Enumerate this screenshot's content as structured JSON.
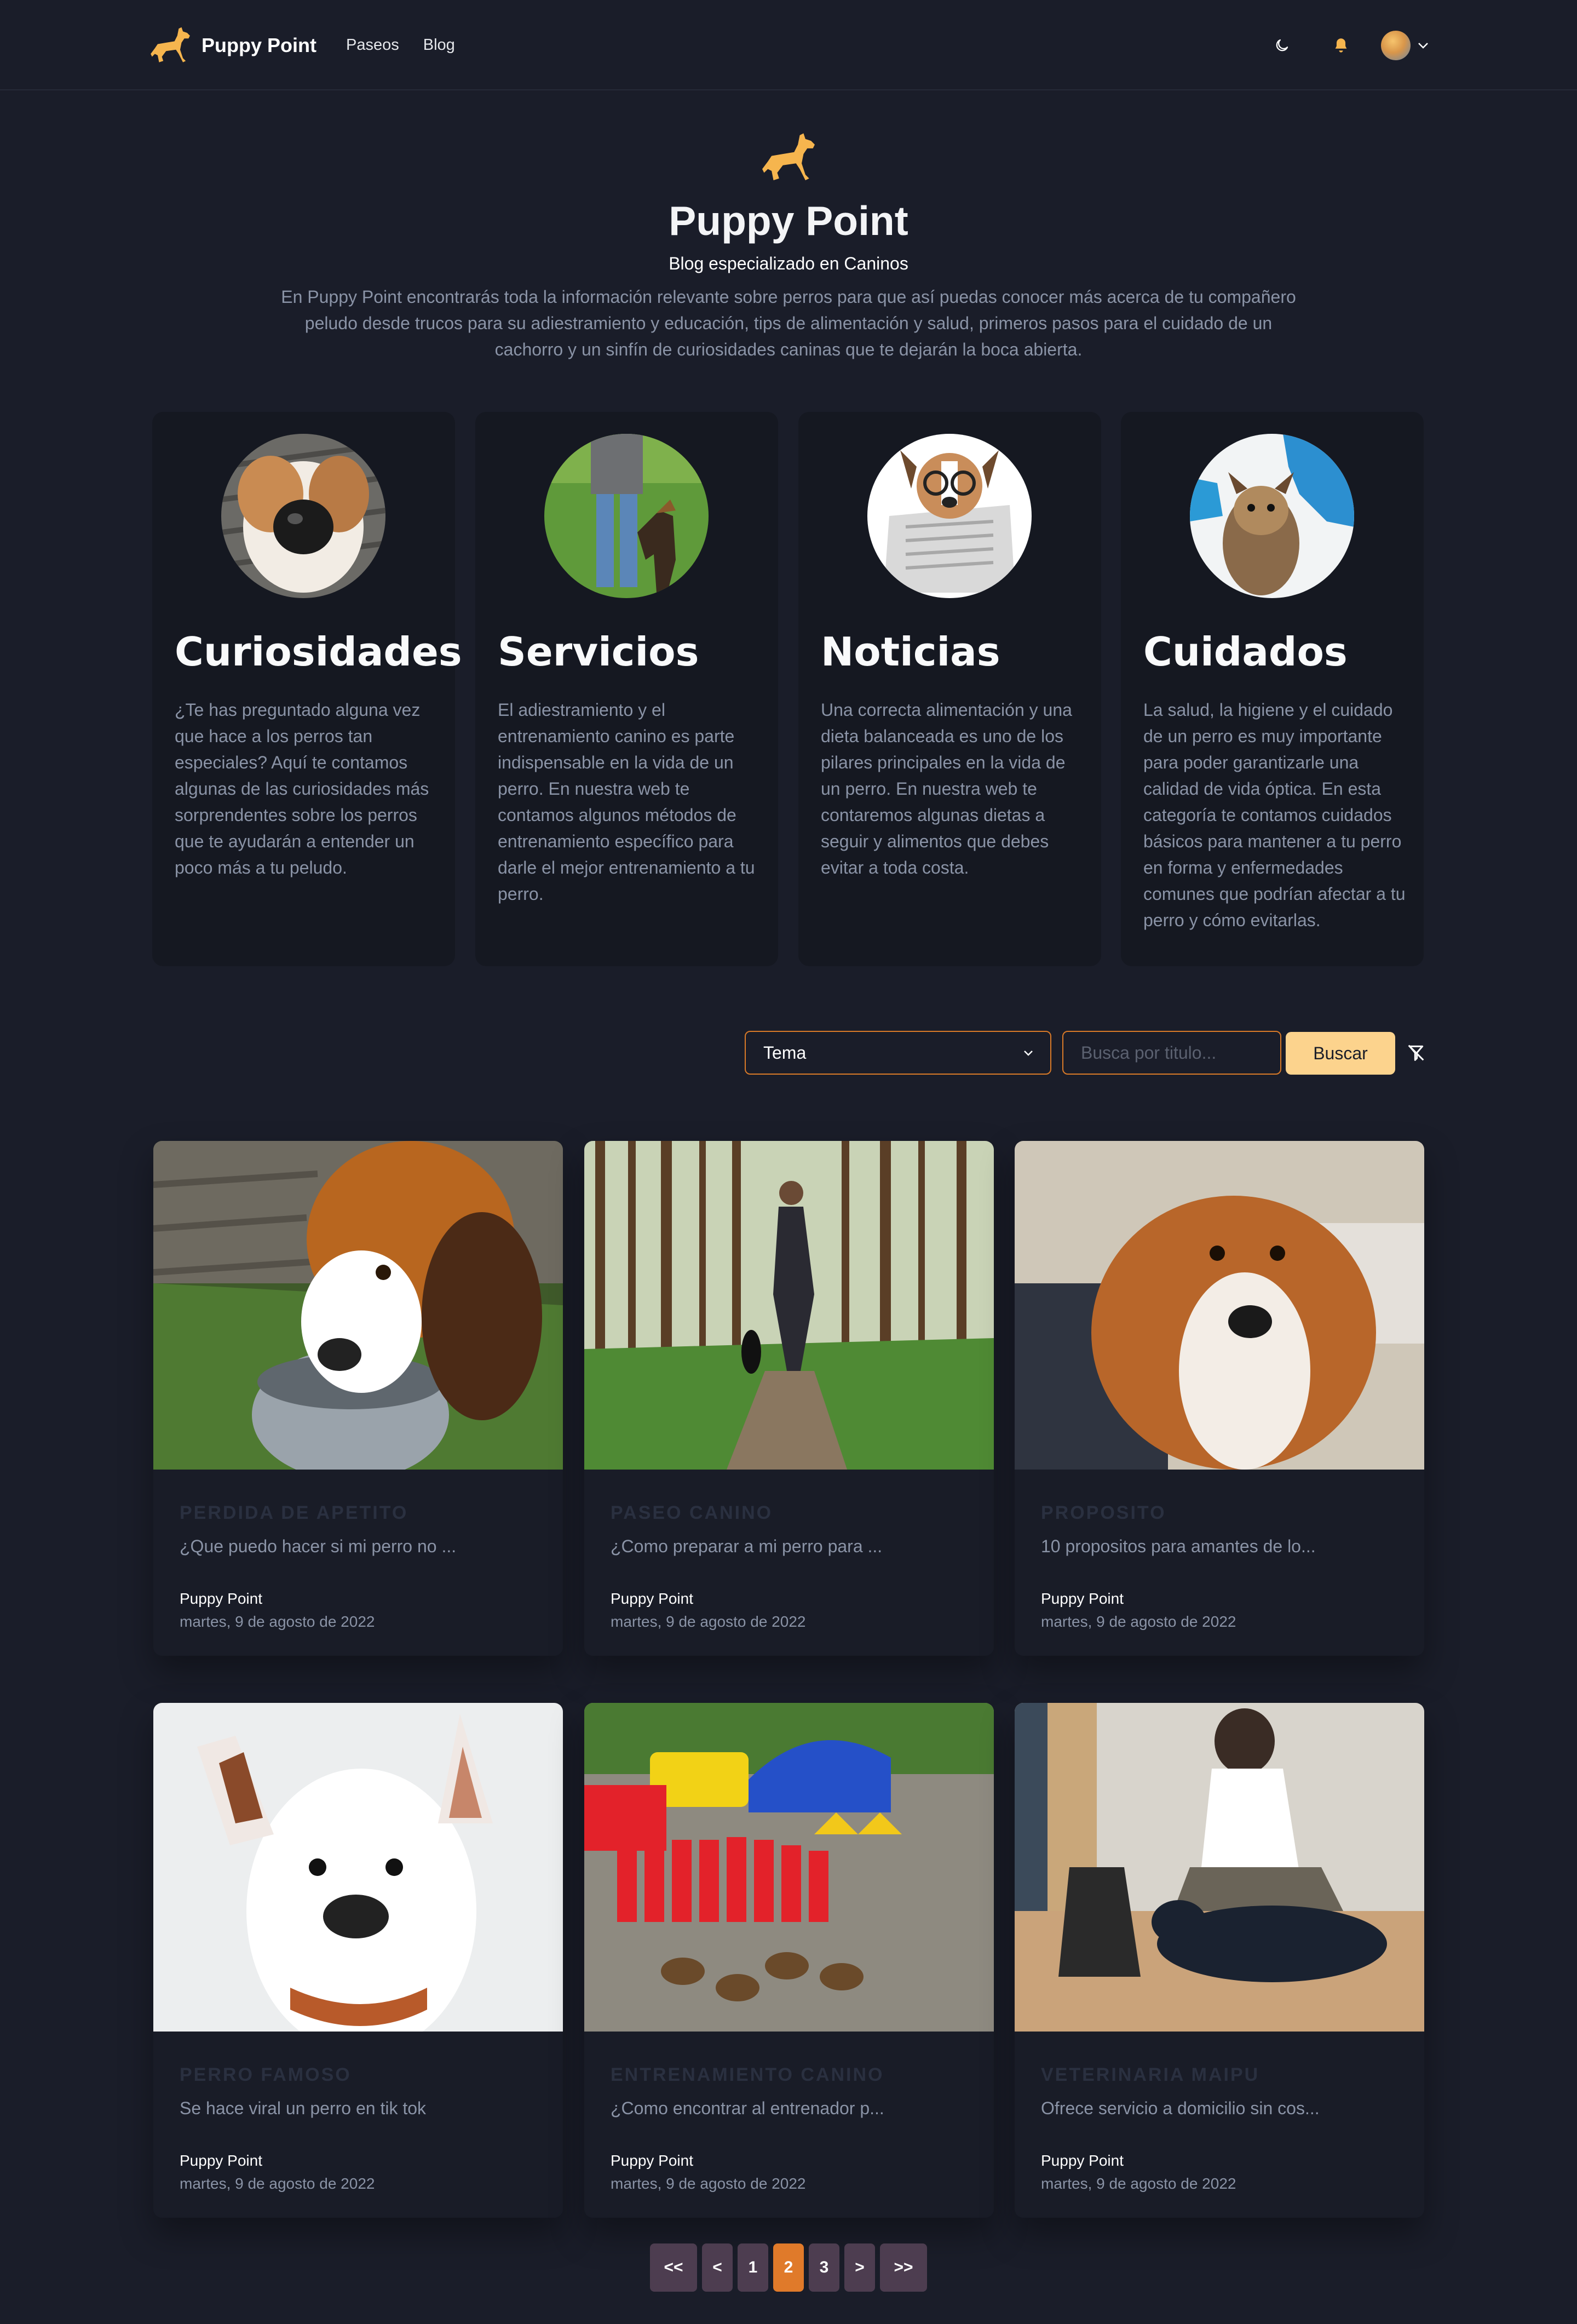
{
  "nav": {
    "brand": "Puppy Point",
    "links": [
      "Paseos",
      "Blog"
    ]
  },
  "hero": {
    "title": "Puppy Point",
    "subtitle": "Blog especializado en Caninos",
    "description": "En Puppy Point encontrarás toda la información relevante sobre perros para que así puedas conocer más acerca de tu compañero peludo desde trucos para su adiestramiento y educación, tips de alimentación y salud, primeros pasos para el cuidado de un cachorro y un sinfín de curiosidades caninas que te dejarán la boca abierta."
  },
  "categories": [
    {
      "title": "Curiosidades",
      "description": "¿Te has preguntado alguna vez que hace a los perros tan especiales? Aquí te contamos algunas de las curiosidades más sorprendentes sobre los perros que te ayudarán a entender un poco más a tu peludo."
    },
    {
      "title": "Servicios",
      "description": "El adiestramiento y el entrenamiento canino es parte indispensable en la vida de un perro. En nuestra web te contamos algunos métodos de entrenamiento específico para darle el mejor entrenamiento a tu perro."
    },
    {
      "title": "Noticias",
      "description": "Una correcta alimentación y una dieta balanceada es uno de los pilares principales en la vida de un perro. En nuestra web te contaremos algunas dietas a seguir y alimentos que debes evitar a toda costa."
    },
    {
      "title": "Cuidados",
      "description": "La salud, la higiene y el cuidado de un perro es muy importante para poder garantizarle una calidad de vida óptica. En esta categoría te contamos cuidados básicos para mantener a tu perro en forma y enfermedades comunes que podrían afectar a tu perro y cómo evitarlas."
    }
  ],
  "filter": {
    "select_label": "Tema",
    "search_placeholder": "Busca por titulo...",
    "search_button": "Buscar"
  },
  "posts": [
    {
      "category": "PERDIDA DE APETITO",
      "excerpt": "¿Que puedo hacer si mi perro no ...",
      "author": "Puppy Point",
      "date": "martes, 9 de agosto de 2022"
    },
    {
      "category": "PASEO CANINO",
      "excerpt": "¿Como preparar a mi perro para ...",
      "author": "Puppy Point",
      "date": "martes, 9 de agosto de 2022"
    },
    {
      "category": "PROPOSITO",
      "excerpt": "10 propositos para amantes de lo...",
      "author": "Puppy Point",
      "date": "martes, 9 de agosto de 2022"
    },
    {
      "category": "PERRO FAMOSO",
      "excerpt": "Se hace viral un perro en tik tok",
      "author": "Puppy Point",
      "date": "martes, 9 de agosto de 2022"
    },
    {
      "category": "ENTRENAMIENTO CANINO",
      "excerpt": "¿Como encontrar al entrenador p...",
      "author": "Puppy Point",
      "date": "martes, 9 de agosto de 2022"
    },
    {
      "category": "VETERINARIA MAIPU",
      "excerpt": "Ofrece servicio a domicilio sin cos...",
      "author": "Puppy Point",
      "date": "martes, 9 de agosto de 2022"
    }
  ],
  "pagination": {
    "first": "<<",
    "prev": "<",
    "pages": [
      "1",
      "2",
      "3"
    ],
    "current": "2",
    "next": ">",
    "last": ">>"
  },
  "colors": {
    "background": "#1a1d29",
    "card": "#151821",
    "accent_orange": "#e07a2a",
    "button_yellow": "#fcd38d",
    "brand_yellow": "#f6b54e"
  }
}
